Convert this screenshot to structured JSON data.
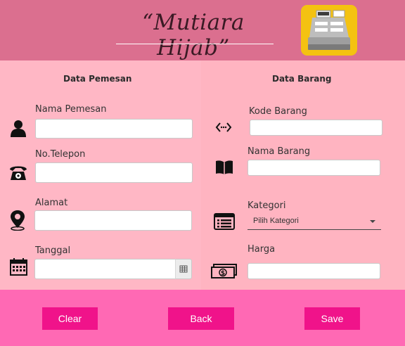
{
  "app": {
    "title": "“Mutiara Hijab”",
    "logo_icon": "cash-register-icon"
  },
  "left": {
    "section_title": "Data Pemesan",
    "fields": {
      "nama_pemesan": {
        "label": "Nama Pemesan",
        "value": "",
        "icon": "person-icon"
      },
      "no_telepon": {
        "label": "No.Telepon",
        "value": "",
        "icon": "telephone-icon"
      },
      "alamat": {
        "label": "Alamat",
        "value": "",
        "icon": "location-pin-icon"
      },
      "tanggal": {
        "label": "Tanggal",
        "value": "",
        "icon": "calendar-icon",
        "picker_icon": "calendar-grid-icon"
      }
    }
  },
  "right": {
    "section_title": "Data Barang",
    "fields": {
      "kode_barang": {
        "label": "Kode Barang",
        "value": "",
        "icon": "code-arrows-icon"
      },
      "nama_barang": {
        "label": "Nama Barang",
        "value": "",
        "icon": "book-icon"
      },
      "kategori": {
        "label": "Kategori",
        "selected": "Pilih Kategori",
        "icon": "list-window-icon"
      },
      "harga": {
        "label": "Harga",
        "value": "",
        "icon": "money-bill-icon"
      }
    }
  },
  "footer": {
    "clear_label": "Clear",
    "back_label": "Back",
    "save_label": "Save"
  },
  "colors": {
    "header": "#db6f8f",
    "left_panel": "#ffb7c5",
    "right_panel": "#ffb4c1",
    "footer": "#ff69b4",
    "button": "#f0138a",
    "logo_bg": "#f4c211"
  }
}
